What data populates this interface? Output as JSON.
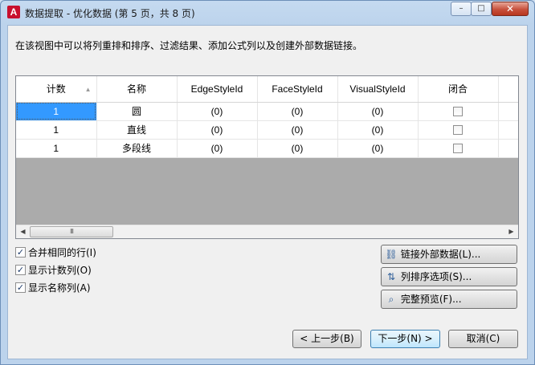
{
  "window": {
    "app_icon": "A",
    "title": "数据提取 - 优化数据 (第 5 页，共 8 页)",
    "min_glyph": "–",
    "max_glyph": "□",
    "close_glyph": "✕"
  },
  "description": "在该视图中可以将列重排和排序、过滤结果、添加公式列以及创建外部数据链接。",
  "grid": {
    "columns": [
      "计数",
      "名称",
      "EdgeStyleId",
      "FaceStyleId",
      "VisualStyleId",
      "闭合"
    ],
    "sort_column": "计数",
    "sort_glyph": "▲",
    "rows": [
      {
        "count": "1",
        "name": "圆",
        "edge": "(0)",
        "face": "(0)",
        "visual": "(0)",
        "closed": false
      },
      {
        "count": "1",
        "name": "直线",
        "edge": "(0)",
        "face": "(0)",
        "visual": "(0)",
        "closed": false
      },
      {
        "count": "1",
        "name": "多段线",
        "edge": "(0)",
        "face": "(0)",
        "visual": "(0)",
        "closed": false
      }
    ],
    "scroll": {
      "left_glyph": "◀",
      "right_glyph": "▶",
      "thumb_glyph": "III"
    }
  },
  "options": [
    {
      "label": "合并相同的行(I)",
      "checked": true,
      "check_glyph": "✓"
    },
    {
      "label": "显示计数列(O)",
      "checked": true,
      "check_glyph": "✓"
    },
    {
      "label": "显示名称列(A)",
      "checked": true,
      "check_glyph": "✓"
    }
  ],
  "side_buttons": [
    {
      "label": "链接外部数据(L)...",
      "icon": "link-icon",
      "glyph": "⛓"
    },
    {
      "label": "列排序选项(S)...",
      "icon": "sort-icon",
      "glyph": "⇅"
    },
    {
      "label": "完整预览(F)...",
      "icon": "preview-icon",
      "glyph": "⌕"
    }
  ],
  "nav": {
    "back": "< 上一步(B)",
    "next": "下一步(N) >",
    "cancel": "取消(C)"
  }
}
